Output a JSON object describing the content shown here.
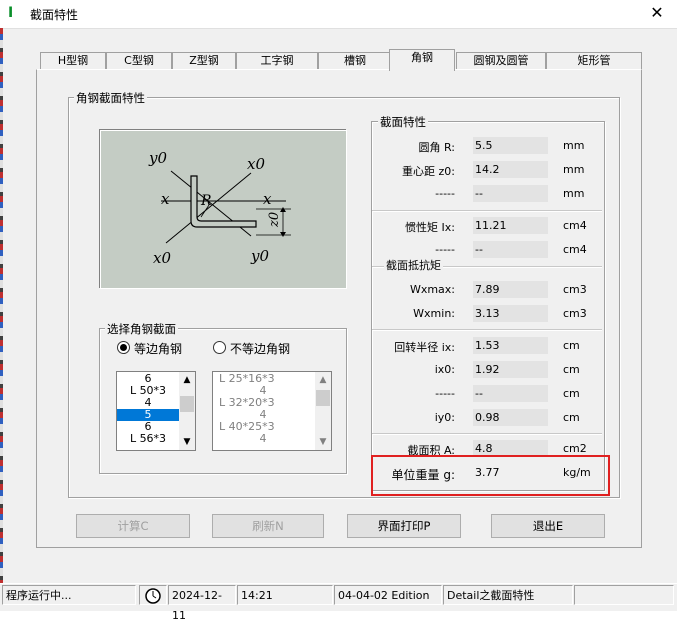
{
  "window": {
    "title": "截面特性",
    "close_glyph": "✕",
    "app_icon_glyph": "I"
  },
  "tabs": [
    "H型钢",
    "C型钢",
    "Z型钢",
    "工字钢",
    "槽钢",
    "角钢",
    "圆钢及圆管",
    "矩形管"
  ],
  "active_tab": "角钢",
  "left_group": {
    "title": "角钢截面特性",
    "diagram": {
      "labels": [
        "y0",
        "x0",
        "x",
        "R",
        "x",
        "z0",
        "x0",
        "y0"
      ]
    },
    "select_group": {
      "title": "选择角钢截面",
      "radio_equal": "等边角钢",
      "radio_unequal": "不等边角钢",
      "equal_selected": true,
      "equal_list": [
        "6",
        "L 50*3",
        "4",
        "5",
        "6",
        "L 56*3"
      ],
      "equal_selected_index": 3,
      "unequal_list": [
        "L 25*16*3",
        "4",
        "L 32*20*3",
        "4",
        "L 40*25*3",
        "4"
      ]
    }
  },
  "props": {
    "title": "截面特性",
    "rows": [
      {
        "label": "圆角   R:",
        "value": "5.5",
        "unit": "mm"
      },
      {
        "label": "重心距 z0:",
        "value": "14.2",
        "unit": "mm"
      },
      {
        "label": "-----",
        "value": "--",
        "unit": "mm"
      },
      {
        "label": "惯性矩 Ix:",
        "value": "11.21",
        "unit": "cm4"
      },
      {
        "label": "-----",
        "value": "--",
        "unit": "cm4"
      },
      {
        "label": "Wxmax:",
        "value": "7.89",
        "unit": "cm3"
      },
      {
        "label": "Wxmin:",
        "value": "3.13",
        "unit": "cm3"
      },
      {
        "label": "回转半径 ix:",
        "value": "1.53",
        "unit": "cm"
      },
      {
        "label": "ix0:",
        "value": "1.92",
        "unit": "cm"
      },
      {
        "label": "-----",
        "value": "--",
        "unit": "cm"
      },
      {
        "label": "iy0:",
        "value": "0.98",
        "unit": "cm"
      },
      {
        "label": "截面积 A:",
        "value": "4.8",
        "unit": "cm2"
      },
      {
        "label": "单位重量 g:",
        "value": "3.77",
        "unit": "kg/m"
      }
    ],
    "modulus_caption": "截面抵抗矩"
  },
  "buttons": {
    "calc": "计算C",
    "refresh": "刷新N",
    "print": "界面打印P",
    "exit": "退出E"
  },
  "status": {
    "running": "程序运行中...",
    "date": "2024-12-11",
    "time": "14:21",
    "edition": "04-04-02 Edition",
    "module": "Detail之截面特性"
  },
  "colors": {
    "highlight": "#e02020",
    "selection": "#0078d7",
    "diagram_bg": "#c4ccc4"
  }
}
